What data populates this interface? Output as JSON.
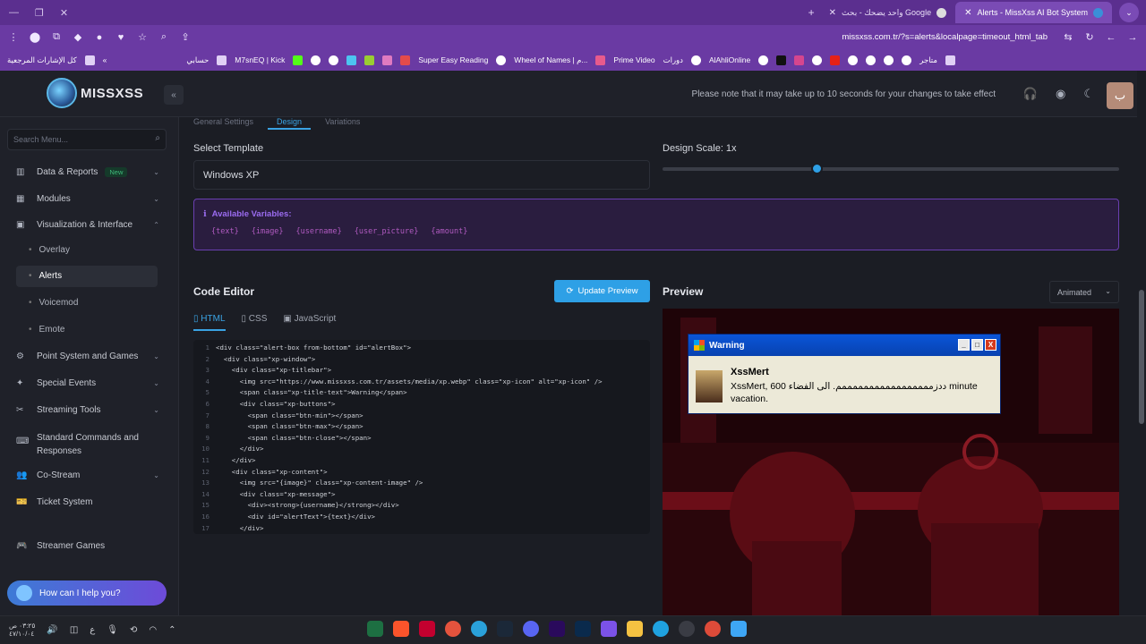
{
  "browser": {
    "tabs": [
      {
        "title": "واحد يضحك - بحث Google"
      },
      {
        "title": "Alerts - MissXss AI Bot System"
      }
    ],
    "url": "missxss.com.tr/?s=alerts&localpage=timeout_html_tab",
    "bookmarks": [
      "كل الإشارات المرجعية",
      "حسابي",
      "M7snEQ | Kick",
      "Super Easy Reading",
      "Wheel of Names | م...",
      "Prime Video",
      "دورات",
      "AlAhliOnline",
      "متاجر"
    ]
  },
  "header": {
    "logo_text": "MISSXSS",
    "notice": "Please note that it may take up to 10 seconds for your changes to take effect",
    "avatar_letter": "ب"
  },
  "sidebar": {
    "search_placeholder": "Search Menu...",
    "items": [
      {
        "label": "Data & Reports",
        "badge": "New",
        "icon": "chart-icon"
      },
      {
        "label": "Modules",
        "icon": "modules-icon"
      },
      {
        "label": "Visualization & Interface",
        "icon": "visual-icon"
      },
      {
        "label": "Point System and Games",
        "icon": "game-icon"
      },
      {
        "label": "Special Events",
        "icon": "star-icon"
      },
      {
        "label": "Streaming Tools",
        "icon": "tools-icon"
      },
      {
        "label": "Standard Commands and Responses",
        "icon": "keyboard-icon"
      },
      {
        "label": "Co-Stream",
        "icon": "users-icon"
      },
      {
        "label": "Ticket System",
        "icon": "ticket-icon"
      },
      {
        "label": "Streamer Games",
        "icon": "gamepad-icon"
      }
    ],
    "subitems": [
      "Overlay",
      "Alerts",
      "Voicemod",
      "Emote"
    ],
    "help": "How can I help you?"
  },
  "main": {
    "tabs": [
      "General Settings",
      "Design",
      "Variations"
    ],
    "select_template_label": "Select Template",
    "template_value": "Windows XP",
    "design_scale_label": "Design Scale: 1x",
    "design_scale_value": 1,
    "variables_title": "Available Variables:",
    "variables": [
      "{text}",
      "{image}",
      "{username}",
      "{user_picture}",
      "{amount}"
    ],
    "code_editor_title": "Code Editor",
    "update_button": "Update Preview",
    "code_tabs": [
      "HTML",
      "CSS",
      "JavaScript"
    ],
    "code_lines": [
      "<div class=\"alert-box from-bottom\" id=\"alertBox\">",
      "  <div class=\"xp-window\">",
      "    <div class=\"xp-titlebar\">",
      "      <img src=\"https://www.missxss.com.tr/assets/media/xp.webp\" class=\"xp-icon\" alt=\"xp-icon\" />",
      "      <span class=\"xp-title-text\">Warning</span>",
      "      <div class=\"xp-buttons\">",
      "        <span class=\"btn-min\"></span>",
      "        <span class=\"btn-max\"></span>",
      "        <span class=\"btn-close\"></span>",
      "      </div>",
      "    </div>",
      "    <div class=\"xp-content\">",
      "      <img src=\"{image}\" class=\"xp-content-image\" />",
      "      <div class=\"xp-message\">",
      "        <div><strong>{username}</strong></div>",
      "        <div id=\"alertText\">{text}</div>",
      "      </div>"
    ],
    "preview_title": "Preview",
    "animation_select": "Animated",
    "xp_title": "Warning",
    "xp_user": "XssMert",
    "xp_message": "XssMert, 600 ددزمممممممممممممممممم. الى الفضاء minute vacation."
  },
  "taskbar": {
    "time": "٠٣:٢٥ ص",
    "date": "٤٧/١٠/٠٤"
  }
}
